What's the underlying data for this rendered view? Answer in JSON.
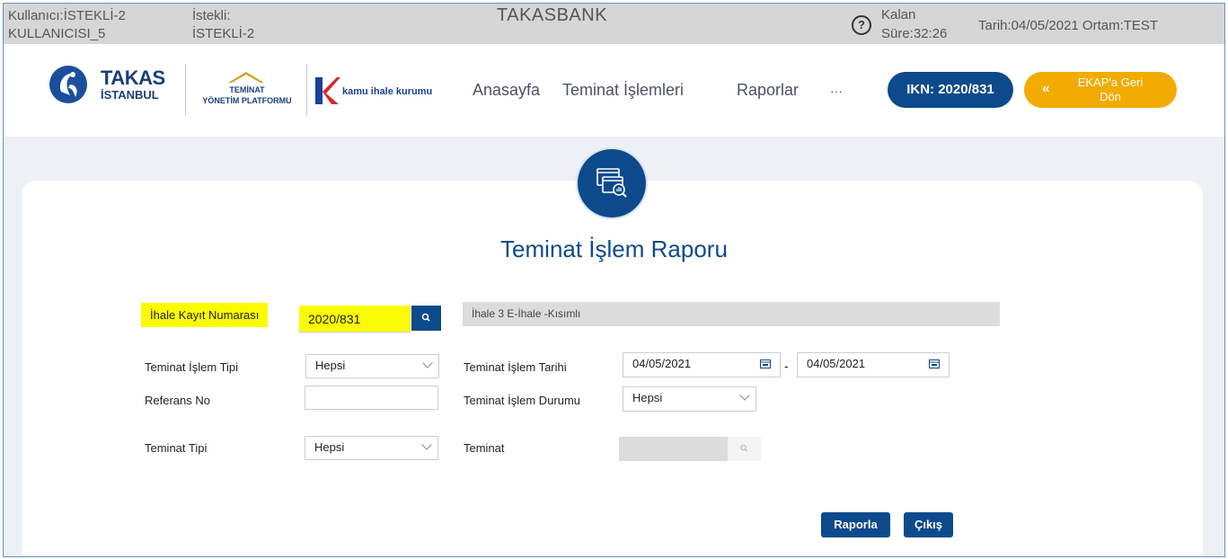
{
  "topbar": {
    "user_label": "Kullanıcı:İSTEKLİ-2",
    "user_line2": "KULLANICISI_5",
    "bidder_label": "İstekli:",
    "bidder_value": "İSTEKLİ-2",
    "brand": "TAKASBANK",
    "help_glyph": "?",
    "remaining_label": "Kalan",
    "remaining_value": "Süre:32:26",
    "date_env": "Tarih:04/05/2021  Ortam:TEST"
  },
  "header": {
    "logo_takas_line1": "TAKAS",
    "logo_takas_line2": "İSTANBUL",
    "logo_teminat_line1": "TEMİNAT",
    "logo_teminat_line2": "YÖNETİM PLATFORMU",
    "logo_kik": "kamu ihale kurumu",
    "nav": [
      "Anasayfa",
      "Teminat İşlemleri",
      "Raporlar",
      "···"
    ],
    "ikn_button": "IKN: 2020/831",
    "ekap_chevron": "«",
    "ekap_line1": "EKAP'a Geri",
    "ekap_line2": "Dön"
  },
  "page": {
    "icon": "report-search-icon",
    "title": "Teminat İşlem Raporu"
  },
  "form": {
    "ikn_label": "İhale Kayıt Numarası",
    "ikn_value": "2020/831",
    "tender_desc": "İhale 3  E-İhale -Kısımlı",
    "islem_tipi_label": "Teminat İşlem Tipi",
    "islem_tipi_value": "Hepsi",
    "islem_tarihi_label": "Teminat İşlem Tarihi",
    "date_from": "04/05/2021",
    "date_sep": "-",
    "date_to": "04/05/2021",
    "referans_label": "Referans No",
    "referans_value": "",
    "islem_durumu_label": "Teminat İşlem Durumu",
    "islem_durumu_value": "Hepsi",
    "teminat_tipi_label": "Teminat Tipi",
    "teminat_tipi_value": "Hepsi",
    "teminat_label": "Teminat",
    "teminat_value": ""
  },
  "actions": {
    "report": "Raporla",
    "exit": "Çıkış"
  },
  "colors": {
    "primary": "#0d4a8c",
    "accent": "#f2ab00",
    "highlight": "#fbfb00",
    "topbar": "#d6d6d6"
  }
}
